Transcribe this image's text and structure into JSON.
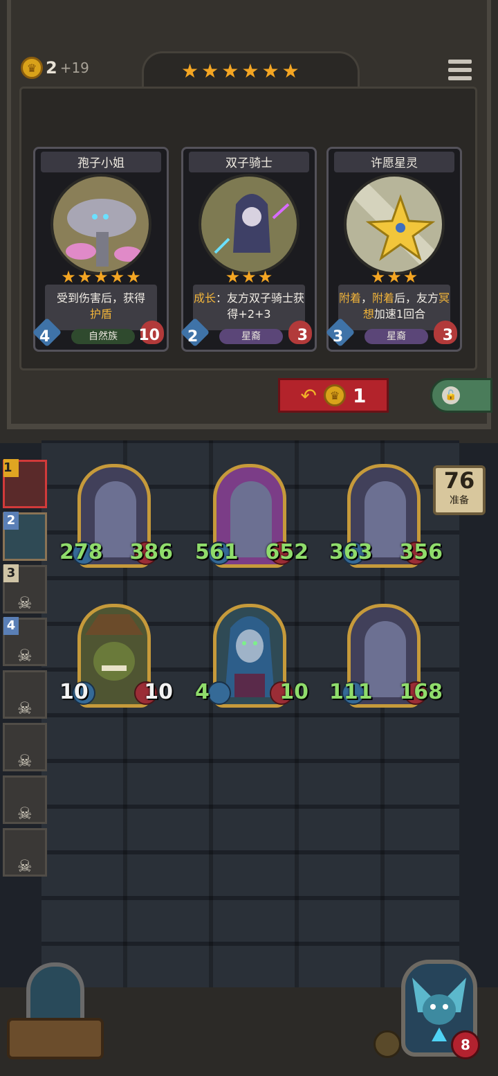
{
  "gold": {
    "value": "2",
    "income": "+19"
  },
  "tavern_stars": [
    "★",
    "★",
    "★",
    "★",
    "★",
    "★"
  ],
  "shop": [
    {
      "name": "孢子小姐",
      "stars": [
        "★",
        "★",
        "★",
        "★",
        "★"
      ],
      "desc_plain": "受到伤害后，获得",
      "desc_hl": "护盾",
      "attack": "4",
      "health": "10",
      "tribe": "自然族",
      "tribe_color": "#2f4a2e",
      "portrait_color": "#8a7f58"
    },
    {
      "name": "双子骑士",
      "stars": [
        "★",
        "★",
        "★"
      ],
      "desc_hl": "成长",
      "desc_plain": "：友方双子骑士获得+2+3",
      "attack": "2",
      "health": "3",
      "tribe": "星裔",
      "tribe_color": "#5b4678",
      "portrait_color": "#7e7a52"
    },
    {
      "name": "许愿星灵",
      "stars": [
        "★",
        "★",
        "★"
      ],
      "desc_hl": "附着",
      "desc_mid": "，",
      "desc_hl2": "附着",
      "desc_plain": "后，友方",
      "desc_hl3": "冥想",
      "desc_end": "加速1回合",
      "attack": "3",
      "health": "3",
      "tribe": "星裔",
      "tribe_color": "#5b4678",
      "portrait_color": "#b7b59a"
    }
  ],
  "refresh": {
    "cost": "1"
  },
  "prep": {
    "value": "76",
    "label": "准备"
  },
  "board": [
    {
      "attack": "278",
      "health": "386",
      "style": ""
    },
    {
      "attack": "561",
      "health": "652",
      "style": "purple"
    },
    {
      "attack": "363",
      "health": "356",
      "style": ""
    },
    {
      "attack": "10",
      "health": "10",
      "style": "green",
      "white": true
    },
    {
      "attack": "4",
      "health": "10",
      "style": "teal",
      "atk_green": true
    },
    {
      "attack": "111",
      "health": "168",
      "style": ""
    }
  ],
  "players": [
    {
      "num": "1"
    },
    {
      "num": "2"
    },
    {
      "num": "3"
    },
    {
      "num": "4"
    }
  ],
  "hero": {
    "health": "8"
  },
  "colors": {
    "accent": "#f4a623",
    "refresh": "#b3232b",
    "stat_green": "#8fdc6b"
  }
}
